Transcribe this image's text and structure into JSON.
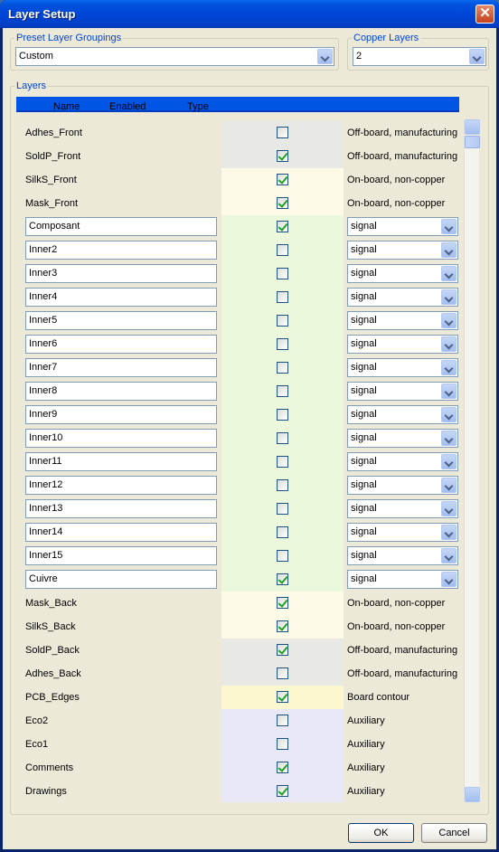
{
  "window": {
    "title": "Layer Setup"
  },
  "preset": {
    "label": "Preset Layer Groupings",
    "value": "Custom"
  },
  "copper": {
    "label": "Copper Layers",
    "value": "2"
  },
  "layers_group": {
    "label": "Layers"
  },
  "columns": {
    "name": "Name",
    "enabled": "Enabled",
    "type": "Type"
  },
  "colors": {
    "tech_gray": "#e8e8e4",
    "silk_cream": "#fdfbe8",
    "copper_green": "#ecf8dc",
    "edge_yellow": "#fbf7cf",
    "aux_lavender": "#e8e8f8",
    "header_blue": "#0055e5"
  },
  "layers": [
    {
      "name": "Adhes_Front",
      "editable": false,
      "enabled": false,
      "type": "Off-board, manufacturing",
      "type_combo": false,
      "color": "tech_gray"
    },
    {
      "name": "SoldP_Front",
      "editable": false,
      "enabled": true,
      "type": "Off-board, manufacturing",
      "type_combo": false,
      "color": "tech_gray"
    },
    {
      "name": "SilkS_Front",
      "editable": false,
      "enabled": true,
      "type": "On-board, non-copper",
      "type_combo": false,
      "color": "silk_cream"
    },
    {
      "name": "Mask_Front",
      "editable": false,
      "enabled": true,
      "type": "On-board, non-copper",
      "type_combo": false,
      "color": "silk_cream"
    },
    {
      "name": "Composant",
      "editable": true,
      "enabled": true,
      "type": "signal",
      "type_combo": true,
      "color": "copper_green"
    },
    {
      "name": "Inner2",
      "editable": true,
      "enabled": false,
      "type": "signal",
      "type_combo": true,
      "color": "copper_green"
    },
    {
      "name": "Inner3",
      "editable": true,
      "enabled": false,
      "type": "signal",
      "type_combo": true,
      "color": "copper_green"
    },
    {
      "name": "Inner4",
      "editable": true,
      "enabled": false,
      "type": "signal",
      "type_combo": true,
      "color": "copper_green"
    },
    {
      "name": "Inner5",
      "editable": true,
      "enabled": false,
      "type": "signal",
      "type_combo": true,
      "color": "copper_green"
    },
    {
      "name": "Inner6",
      "editable": true,
      "enabled": false,
      "type": "signal",
      "type_combo": true,
      "color": "copper_green"
    },
    {
      "name": "Inner7",
      "editable": true,
      "enabled": false,
      "type": "signal",
      "type_combo": true,
      "color": "copper_green"
    },
    {
      "name": "Inner8",
      "editable": true,
      "enabled": false,
      "type": "signal",
      "type_combo": true,
      "color": "copper_green"
    },
    {
      "name": "Inner9",
      "editable": true,
      "enabled": false,
      "type": "signal",
      "type_combo": true,
      "color": "copper_green"
    },
    {
      "name": "Inner10",
      "editable": true,
      "enabled": false,
      "type": "signal",
      "type_combo": true,
      "color": "copper_green"
    },
    {
      "name": "Inner11",
      "editable": true,
      "enabled": false,
      "type": "signal",
      "type_combo": true,
      "color": "copper_green"
    },
    {
      "name": "Inner12",
      "editable": true,
      "enabled": false,
      "type": "signal",
      "type_combo": true,
      "color": "copper_green"
    },
    {
      "name": "Inner13",
      "editable": true,
      "enabled": false,
      "type": "signal",
      "type_combo": true,
      "color": "copper_green"
    },
    {
      "name": "Inner14",
      "editable": true,
      "enabled": false,
      "type": "signal",
      "type_combo": true,
      "color": "copper_green"
    },
    {
      "name": "Inner15",
      "editable": true,
      "enabled": false,
      "type": "signal",
      "type_combo": true,
      "color": "copper_green"
    },
    {
      "name": "Cuivre",
      "editable": true,
      "enabled": true,
      "type": "signal",
      "type_combo": true,
      "color": "copper_green"
    },
    {
      "name": "Mask_Back",
      "editable": false,
      "enabled": true,
      "type": "On-board, non-copper",
      "type_combo": false,
      "color": "silk_cream"
    },
    {
      "name": "SilkS_Back",
      "editable": false,
      "enabled": true,
      "type": "On-board, non-copper",
      "type_combo": false,
      "color": "silk_cream"
    },
    {
      "name": "SoldP_Back",
      "editable": false,
      "enabled": true,
      "type": "Off-board, manufacturing",
      "type_combo": false,
      "color": "tech_gray"
    },
    {
      "name": "Adhes_Back",
      "editable": false,
      "enabled": false,
      "type": "Off-board, manufacturing",
      "type_combo": false,
      "color": "tech_gray"
    },
    {
      "name": "PCB_Edges",
      "editable": false,
      "enabled": true,
      "type": "Board contour",
      "type_combo": false,
      "color": "edge_yellow"
    },
    {
      "name": "Eco2",
      "editable": false,
      "enabled": false,
      "type": "Auxiliary",
      "type_combo": false,
      "color": "aux_lavender"
    },
    {
      "name": "Eco1",
      "editable": false,
      "enabled": false,
      "type": "Auxiliary",
      "type_combo": false,
      "color": "aux_lavender"
    },
    {
      "name": "Comments",
      "editable": false,
      "enabled": true,
      "type": "Auxiliary",
      "type_combo": false,
      "color": "aux_lavender"
    },
    {
      "name": "Drawings",
      "editable": false,
      "enabled": true,
      "type": "Auxiliary",
      "type_combo": false,
      "color": "aux_lavender"
    }
  ],
  "buttons": {
    "ok": "OK",
    "cancel": "Cancel"
  }
}
